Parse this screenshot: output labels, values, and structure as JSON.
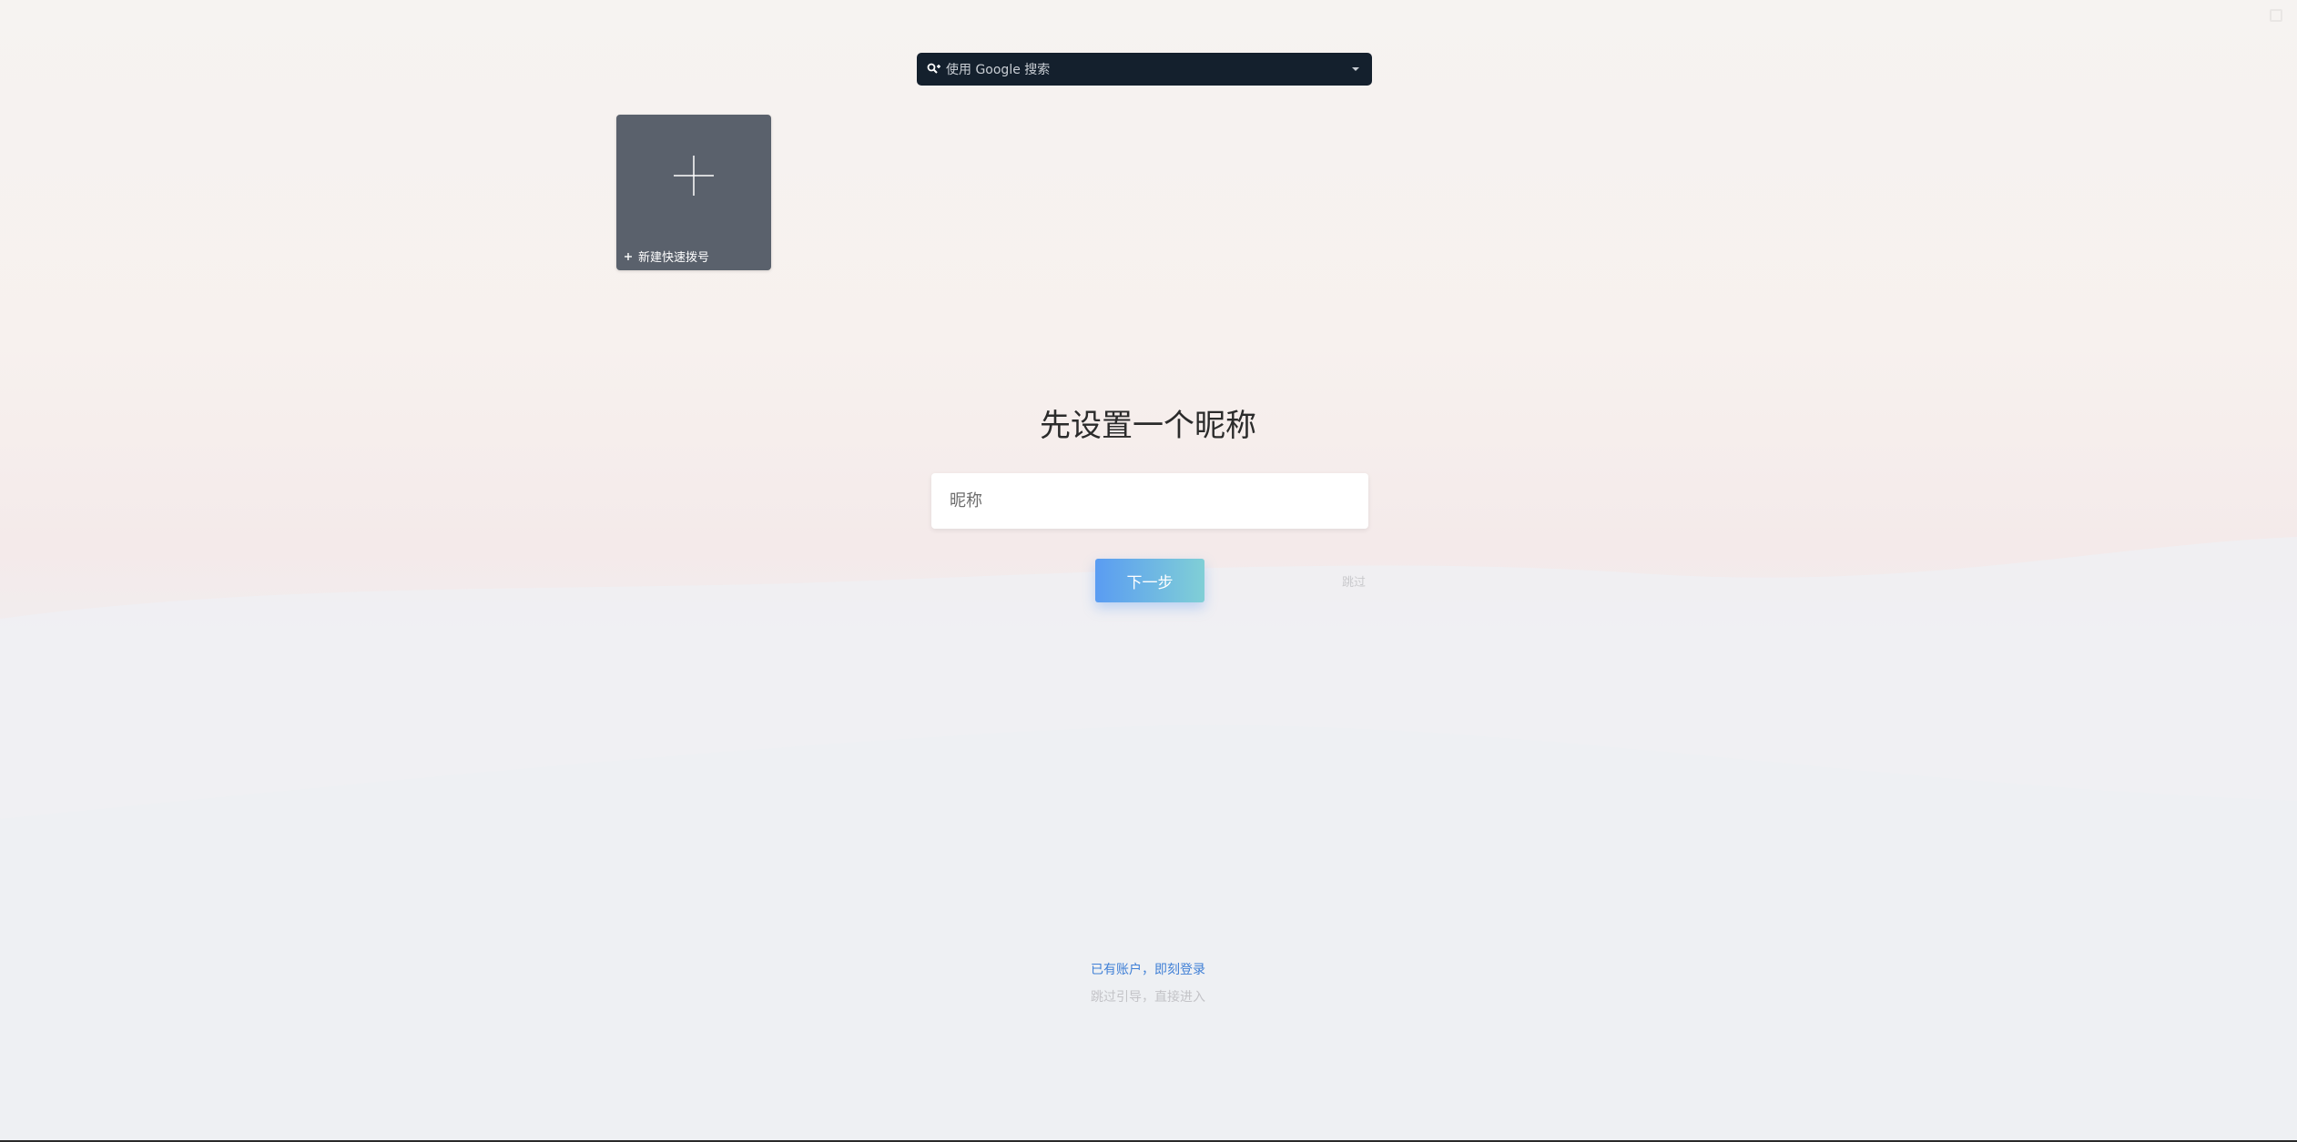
{
  "search": {
    "placeholder": "使用 Google 搜索",
    "engine_icon": "search-key-icon",
    "dropdown_icon": "chevron-down-icon"
  },
  "speed_dial": {
    "label": "新建快速拨号",
    "icon": "plus-icon"
  },
  "onboarding": {
    "heading": "先设置一个昵称",
    "nickname_placeholder": "昵称",
    "next_label": "下一步",
    "skip_label": "跳过"
  },
  "footer": {
    "login_link": "已有账户，即刻登录",
    "skip_guide": "跳过引导，直接进入"
  },
  "colors": {
    "search_bg": "#14202d",
    "tile_bg": "#5a616c",
    "button_gradient_start": "#5a9cf2",
    "button_gradient_end": "#80cfd6",
    "link": "#3f7fd6"
  }
}
